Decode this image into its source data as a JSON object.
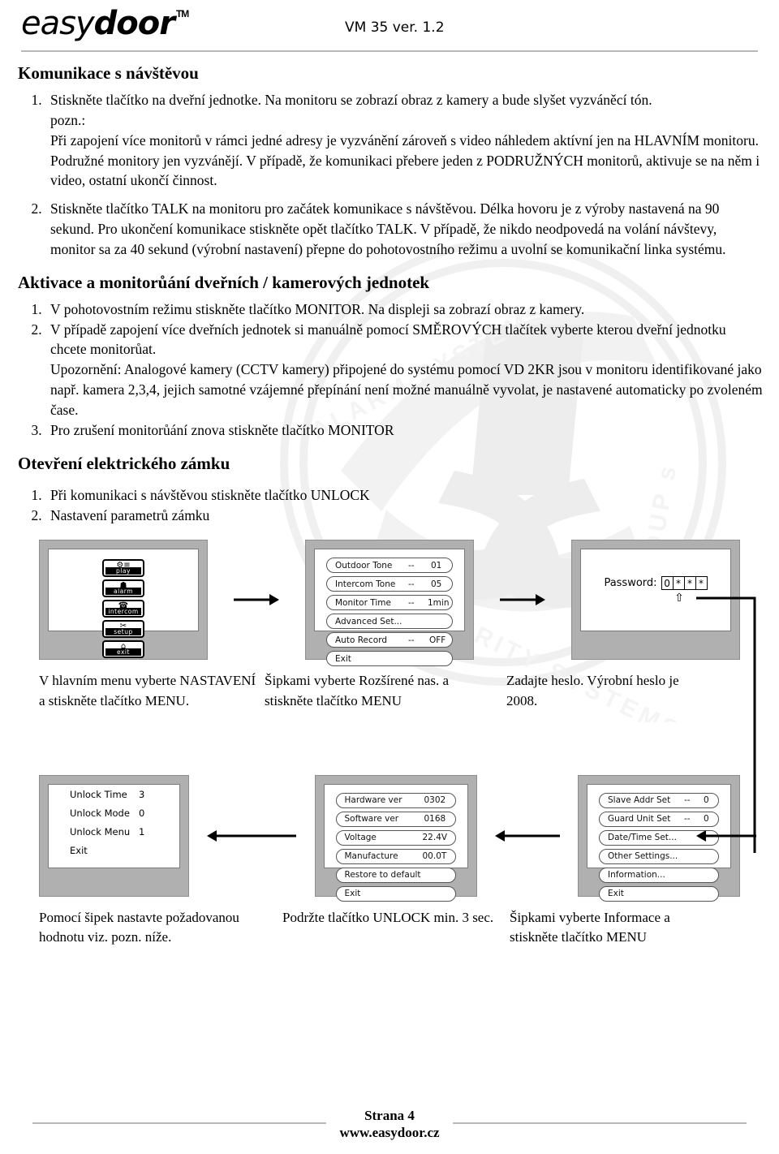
{
  "header": {
    "logo_light": "easy",
    "logo_bold": "door",
    "logo_tm": "TM",
    "model": "VM 35 ver. 1.2"
  },
  "sections": [
    {
      "id": "komunikace",
      "title": "Komunikace s návštěvou",
      "steps": [
        "Stiskněte tlačítko na dveřní jednotke. Na monitoru se zobrazí obraz z kamery a bude slyšet vyzváněcí tón.",
        "pozn.:",
        "Při zapojení více monitorů v rámci jedné adresy je vyzvánění zároveň s video náhledem aktívní jen na HLAVNÍM  monitoru. Podružné monitory jen vyzvánějí. V případě, že komunikaci přebere jeden z PODRUŽNÝCH monitorů, aktivuje se na něm i video, ostatní ukončí činnost.",
        "Stiskněte tlačítko TALK na monitoru pro začátek komunikace s návštěvou. Délka hovoru je z výroby nastavená na 90 sekund. Pro ukončení komunikace stiskněte opět tlačítko TALK. V případě, že nikdo neodpovedá na volání návštevy, monitor sa za 40 sekund (výrobní nastavení) přepne do pohotovostního režimu a uvolní se komunikační linka systému."
      ]
    },
    {
      "id": "aktivace",
      "title": "Aktivace a monitorůání dveřních / kamerových jednotek",
      "steps": [
        "V pohotovostním režimu stiskněte tlačítko MONITOR. Na displeji sa zobrazí obraz z kamery.",
        "V případě zapojení více dveřních jednotek si manuálně pomocí SMĚROVÝCH tlačítek vyberte kterou dveřní jednotku chcete monitorůat.",
        "Upozornění: Analogové kamery (CCTV kamery) připojené do systému pomocí VD 2KR jsou v monitoru identifikované jako např. kamera 2,3,4, jejich samotné  vzájemné přepínání není možné manuálně vyvolat, je nastavené automaticky po zvoleném čase.",
        "Pro zrušení monitorůání znova stiskněte tlačítko MONITOR"
      ]
    },
    {
      "id": "otevreni",
      "title": "Otevření elektrického zámku",
      "steps": [
        "Při komunikaci s návštěvou stiskněte tlačítko UNLOCK",
        "Nastavení parametrů zámku"
      ]
    }
  ],
  "diagram": {
    "row1": {
      "main_menu": {
        "items": [
          {
            "caption": "play",
            "glyph": "⚙≡"
          },
          {
            "caption": "alarm",
            "glyph": "☗"
          },
          {
            "caption": "intercom",
            "glyph": "☎"
          },
          {
            "caption": "setup",
            "glyph": "✂"
          },
          {
            "caption": "exit",
            "glyph": "⌂"
          }
        ]
      },
      "settings_menu": {
        "items": [
          {
            "label": "Outdoor Tone",
            "dash": "--",
            "value": "01"
          },
          {
            "label": "Intercom Tone",
            "dash": "--",
            "value": "05"
          },
          {
            "label": "Monitor Time",
            "dash": "--",
            "value": "1min"
          },
          {
            "label": "Advanced Set...",
            "dash": "",
            "value": ""
          },
          {
            "label": "Auto Record",
            "dash": "--",
            "value": "OFF"
          },
          {
            "label": "Exit",
            "dash": "",
            "value": ""
          }
        ]
      },
      "password_screen": {
        "label": "Password:",
        "chars": [
          "0",
          "*",
          "*",
          "*"
        ],
        "cursor": "⇧"
      },
      "captions": [
        "V hlavním menu vyberte NASTAVENÍ a stiskněte tlačítko MENU.",
        "Šipkami vyberte Rozšírené nas. a stiskněte tlačítko MENU",
        "Zadajte heslo. Výrobní heslo je 2008."
      ]
    },
    "row2": {
      "unlock_menu": {
        "rows": [
          {
            "key": "Unlock Time",
            "value": "3"
          },
          {
            "key": "Unlock Mode",
            "value": "0"
          },
          {
            "key": "Unlock Menu",
            "value": "1"
          },
          {
            "key": "Exit",
            "value": ""
          }
        ]
      },
      "info_menu": {
        "items": [
          {
            "label": "Hardware ver",
            "value": "0302"
          },
          {
            "label": "Software ver",
            "value": "0168"
          },
          {
            "label": "Voltage",
            "value": "22.4V"
          },
          {
            "label": "Manufacture",
            "value": "00.0T"
          },
          {
            "label": "Restore to default",
            "value": ""
          },
          {
            "label": "Exit",
            "value": ""
          }
        ]
      },
      "advanced_menu": {
        "items": [
          {
            "label": "Slave Addr Set",
            "dash": "--",
            "value": "0"
          },
          {
            "label": "Guard Unit Set",
            "dash": "--",
            "value": "0"
          },
          {
            "label": "Date/Time Set...",
            "dash": "",
            "value": ""
          },
          {
            "label": "Other Settings...",
            "dash": "",
            "value": ""
          },
          {
            "label": "Information...",
            "dash": "",
            "value": ""
          },
          {
            "label": "Exit",
            "dash": "",
            "value": ""
          }
        ]
      },
      "captions": [
        "Pomocí šipek nastavte požadovanou hodnotu viz. pozn. níže.",
        "Podržte tlačítko UNLOCK min. 3 sec.",
        "Šipkami vyberte Informace a stiskněte tlačítko MENU"
      ]
    }
  },
  "watermark": {
    "text_top": "ALARM SYSTEMS",
    "text_bottom": "TOTAL SECURITY SYSTEMS",
    "mark": "SS",
    "group": "GROUP s"
  },
  "footer": {
    "page": "Strana 4",
    "site": "www.easydoor.cz"
  },
  "colors": {
    "rule": "#b8b8b8",
    "bezel": "#b0b0b0",
    "screen": "#ffffff",
    "text": "#000000"
  }
}
